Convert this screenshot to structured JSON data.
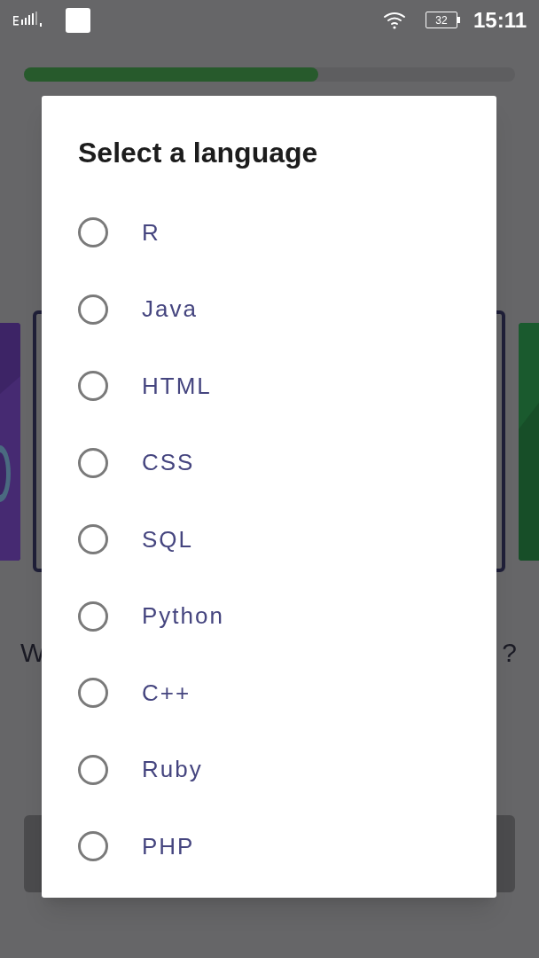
{
  "status_bar": {
    "battery": "32",
    "time": "15:11"
  },
  "progress": {
    "level": 0.6
  },
  "question": {
    "start": "W",
    "end": "?"
  },
  "dialog": {
    "title": "Select a language",
    "options": [
      {
        "label": "R",
        "selected": false
      },
      {
        "label": "Java",
        "selected": false
      },
      {
        "label": "HTML",
        "selected": false
      },
      {
        "label": "CSS",
        "selected": false
      },
      {
        "label": "SQL",
        "selected": false
      },
      {
        "label": "Python",
        "selected": false
      },
      {
        "label": "C++",
        "selected": false
      },
      {
        "label": "Ruby",
        "selected": false
      },
      {
        "label": "PHP",
        "selected": false
      }
    ]
  }
}
